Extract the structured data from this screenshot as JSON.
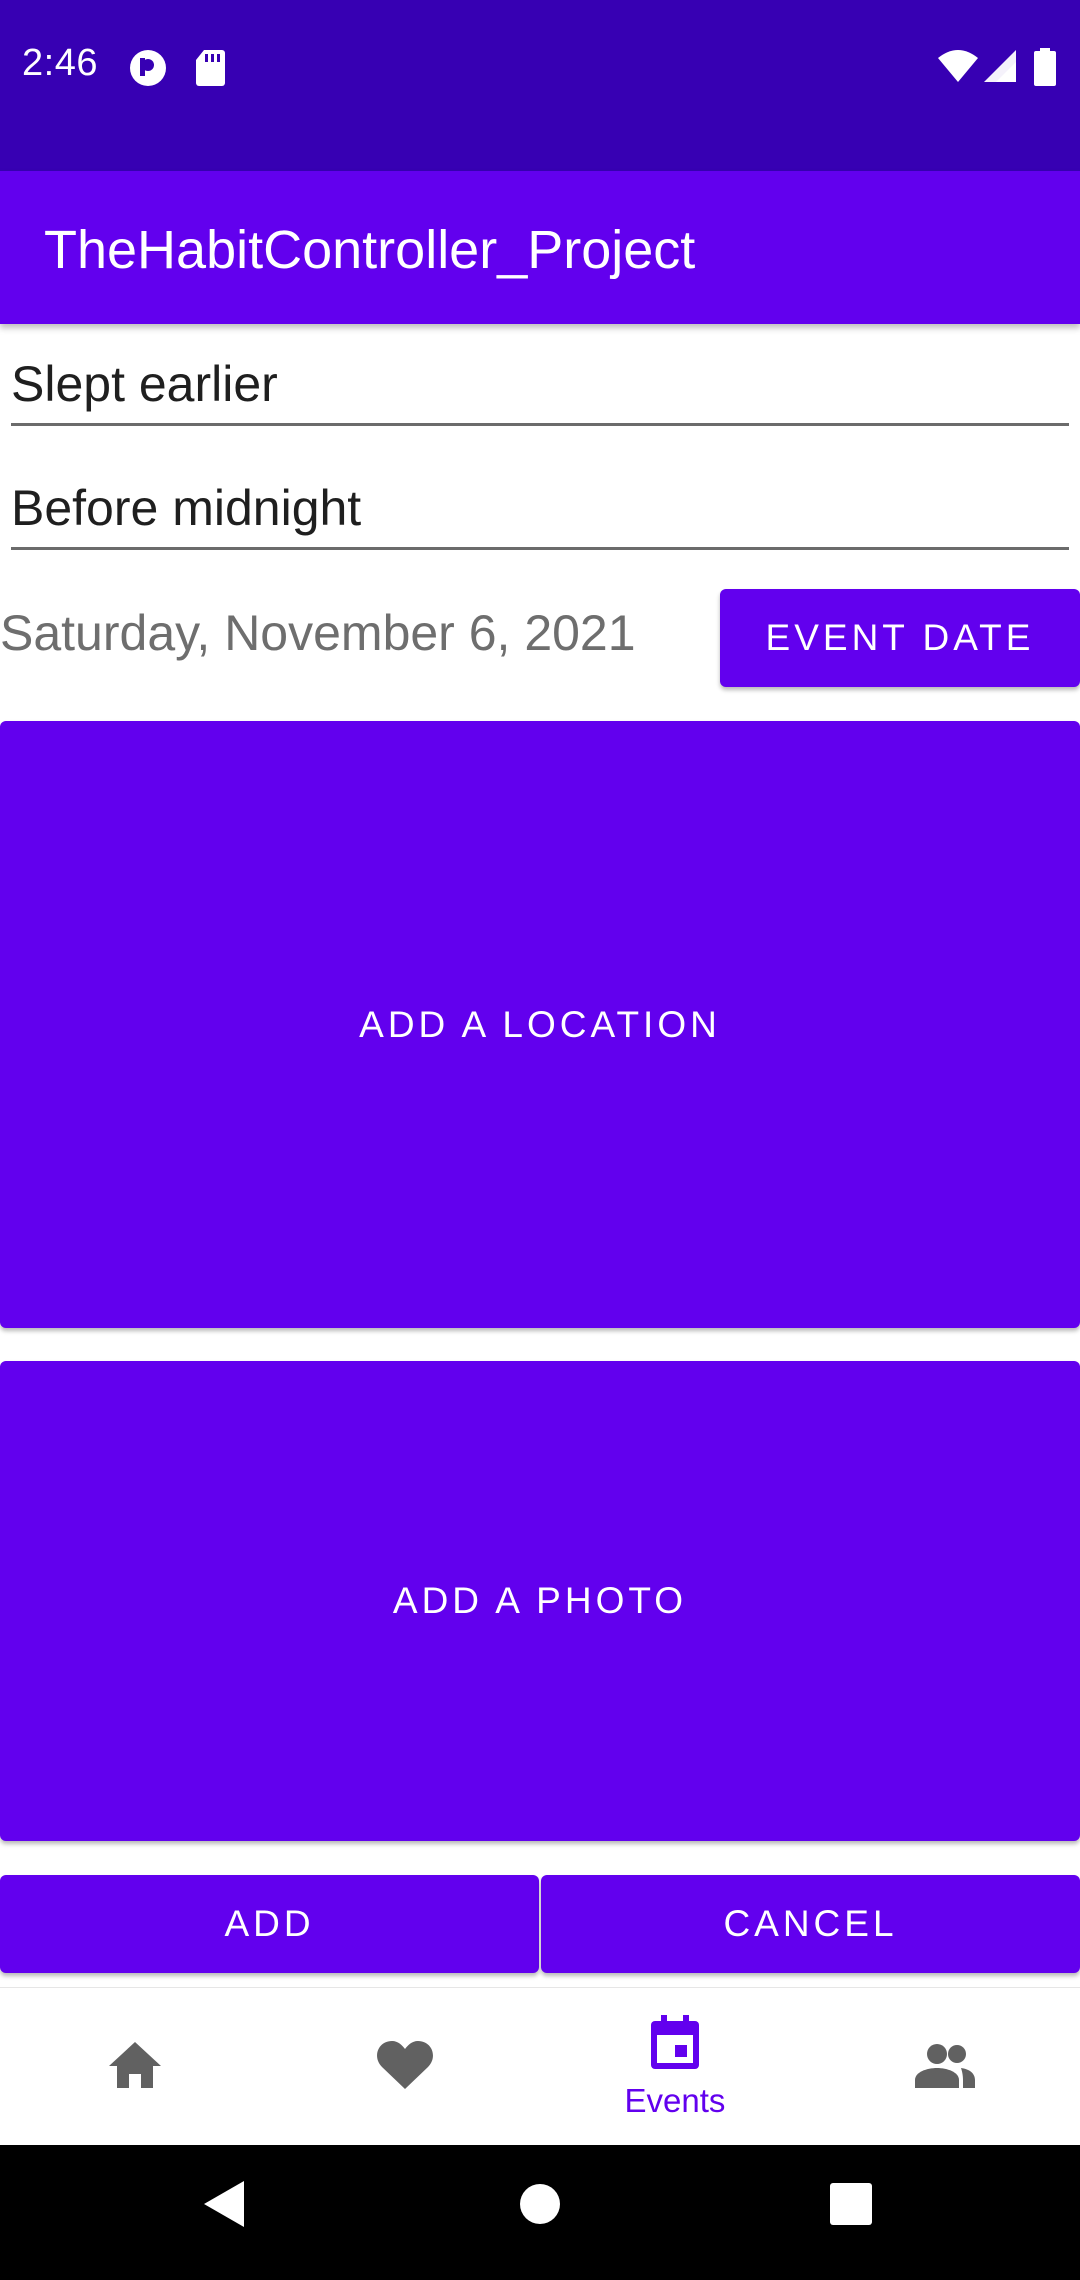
{
  "status_bar": {
    "time": "2:46",
    "icons": [
      "record-icon",
      "sd-card-icon",
      "wifi-icon",
      "cell-signal-icon",
      "battery-icon"
    ]
  },
  "app_bar": {
    "title": "TheHabitController_Project"
  },
  "form": {
    "title_value": "Slept earlier",
    "reason_value": "Before midnight",
    "date_text": "Saturday, November 6, 2021",
    "event_date_label": "EVENT DATE",
    "add_location_label": "ADD A LOCATION",
    "add_photo_label": "ADD A PHOTO",
    "add_label": "ADD",
    "cancel_label": "CANCEL"
  },
  "bottom_nav": {
    "items": [
      {
        "icon": "home-icon",
        "label": "",
        "active": false
      },
      {
        "icon": "heart-icon",
        "label": "",
        "active": false
      },
      {
        "icon": "calendar-icon",
        "label": "Events",
        "active": true
      },
      {
        "icon": "people-icon",
        "label": "",
        "active": false
      }
    ]
  },
  "colors": {
    "primary": "#6200EE",
    "primary_dark": "#3700B3",
    "inactive_icon": "#616161"
  }
}
